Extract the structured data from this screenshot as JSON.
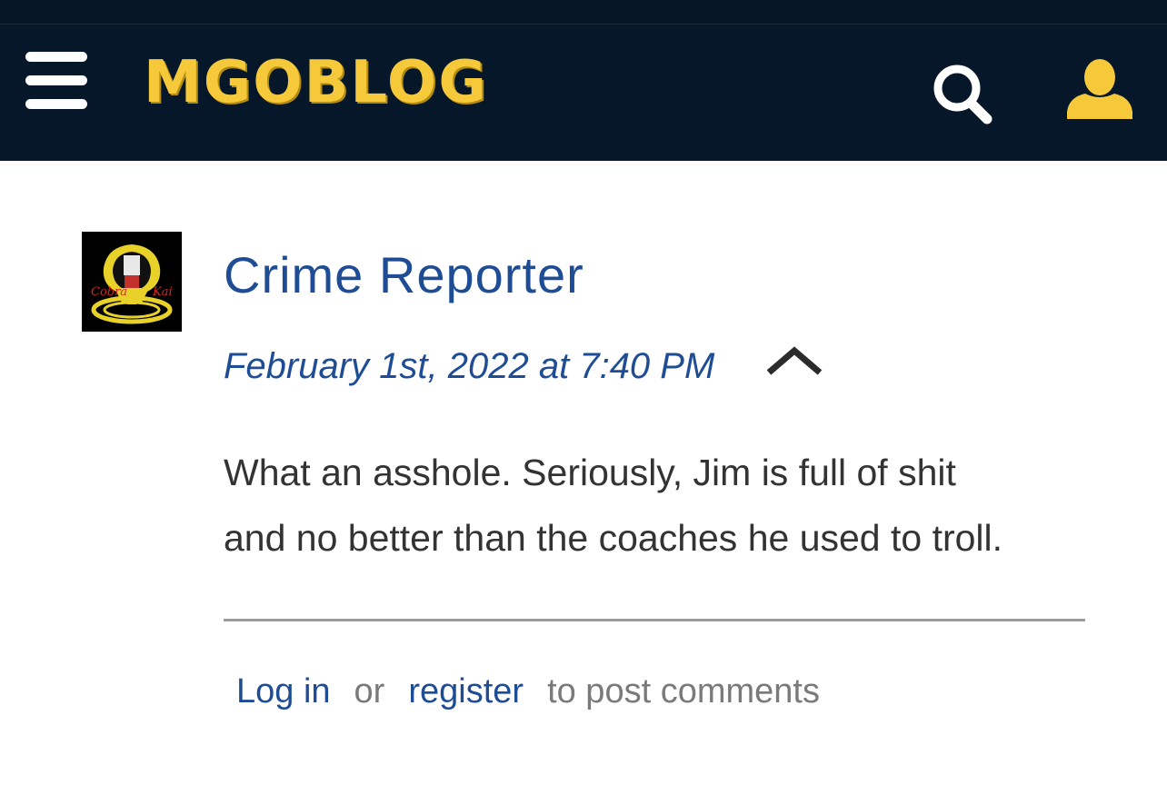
{
  "header": {
    "brand": "MGOBLOG",
    "menu_icon": "hamburger-menu-icon",
    "search_icon": "search-icon",
    "user_icon": "user-icon",
    "colors": {
      "background": "#06172A",
      "brand": "#F5C93A",
      "icon": "#FFFFFF"
    }
  },
  "comment": {
    "avatar_text": {
      "left": "Cobra",
      "right": "Kai"
    },
    "author": "Crime Reporter",
    "timestamp": "February 1st, 2022 at 7:40 PM",
    "collapse_icon": "chevron-up-icon",
    "body_lines": [
      "What an asshole. Seriously, Jim is full of shit",
      "and no better than the coaches he used to troll."
    ],
    "colors": {
      "link": "#1F4D95",
      "text": "#333333"
    }
  },
  "footer": {
    "login_label": "Log in",
    "or_label": "or",
    "register_label": "register",
    "suffix": "to post comments"
  }
}
